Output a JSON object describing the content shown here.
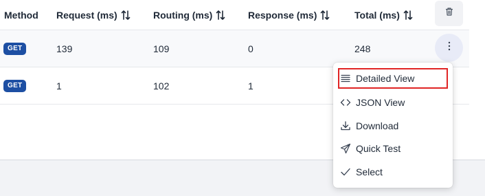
{
  "table": {
    "columns": [
      {
        "label": "Method",
        "sortable": false
      },
      {
        "label": "Request (ms)",
        "sortable": true
      },
      {
        "label": "Routing (ms)",
        "sortable": true
      },
      {
        "label": "Response (ms)",
        "sortable": true
      },
      {
        "label": "Total (ms)",
        "sortable": true
      }
    ],
    "rows": [
      {
        "method": "GET",
        "request": "139",
        "routing": "109",
        "response": "0",
        "total": "248"
      },
      {
        "method": "GET",
        "request": "1",
        "routing": "102",
        "response": "1",
        "total": ""
      }
    ],
    "header_actions": {
      "delete_icon": "trash-icon"
    },
    "row_actions": {
      "more_icon": "more-vertical-icon"
    }
  },
  "context_menu": {
    "items": [
      {
        "label": "Detailed View",
        "icon": "lines-icon",
        "highlighted": true
      },
      {
        "label": "JSON View",
        "icon": "code-icon",
        "highlighted": false
      },
      {
        "label": "Download",
        "icon": "download-icon",
        "highlighted": false
      },
      {
        "label": "Quick Test",
        "icon": "send-icon",
        "highlighted": false
      },
      {
        "label": "Select",
        "icon": "check-icon",
        "highlighted": false
      }
    ]
  },
  "colors": {
    "method_badge": "#1d4fa3",
    "highlight_border": "#e02424",
    "more_button_bg": "#e8ebf7",
    "footer_bg": "#f2f3f6"
  }
}
